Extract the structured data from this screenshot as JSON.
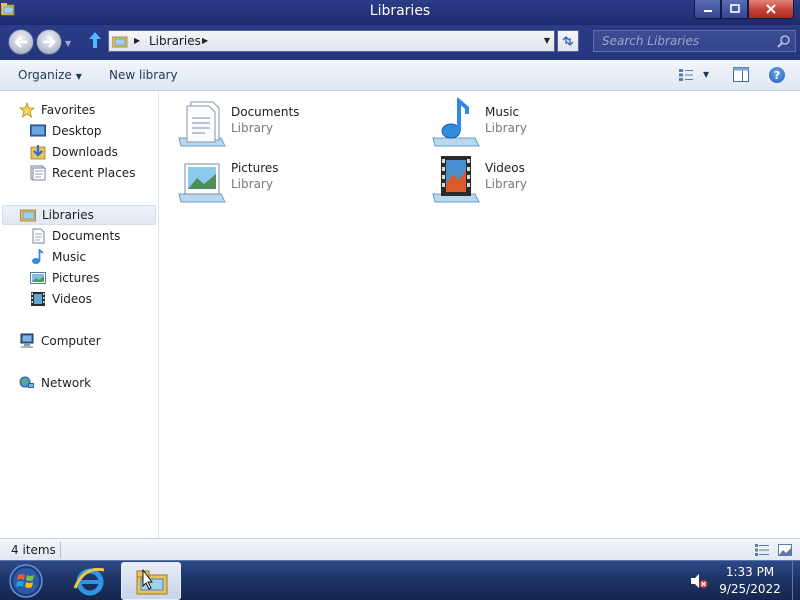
{
  "window": {
    "title": "Libraries",
    "icon": "library-folder-icon",
    "controls": [
      "minimize-icon",
      "maximize-icon",
      "close-icon"
    ]
  },
  "nav": {
    "breadcrumb": [
      "Libraries"
    ],
    "search_placeholder": "Search Libraries"
  },
  "toolbar": {
    "organize_label": "Organize",
    "new_library_label": "New library"
  },
  "sidebar": {
    "favorites": {
      "label": "Favorites",
      "icon": "star-icon",
      "items": [
        {
          "label": "Desktop",
          "icon": "desktop-icon"
        },
        {
          "label": "Downloads",
          "icon": "downloads-icon"
        },
        {
          "label": "Recent Places",
          "icon": "recent-places-icon"
        }
      ]
    },
    "libraries": {
      "label": "Libraries",
      "icon": "libraries-icon",
      "selected": true,
      "items": [
        {
          "label": "Documents",
          "icon": "documents-icon"
        },
        {
          "label": "Music",
          "icon": "music-icon"
        },
        {
          "label": "Pictures",
          "icon": "pictures-icon"
        },
        {
          "label": "Videos",
          "icon": "videos-icon"
        }
      ]
    },
    "computer": {
      "label": "Computer",
      "icon": "computer-icon"
    },
    "network": {
      "label": "Network",
      "icon": "network-icon"
    }
  },
  "content": {
    "libraries": [
      {
        "name": "Documents",
        "type": "Library",
        "icon": "documents-library-icon"
      },
      {
        "name": "Music",
        "type": "Library",
        "icon": "music-library-icon"
      },
      {
        "name": "Pictures",
        "type": "Library",
        "icon": "pictures-library-icon"
      },
      {
        "name": "Videos",
        "type": "Library",
        "icon": "videos-library-icon"
      }
    ]
  },
  "status": {
    "item_count": "4 items"
  },
  "taskbar": {
    "clock_time": "1:33 PM",
    "clock_date": "9/25/2022"
  },
  "colors": {
    "title_bar": "#22327a",
    "command_bar": "#e6edf6",
    "taskbar": "#1d3467",
    "selection": "#dfe8f3"
  }
}
